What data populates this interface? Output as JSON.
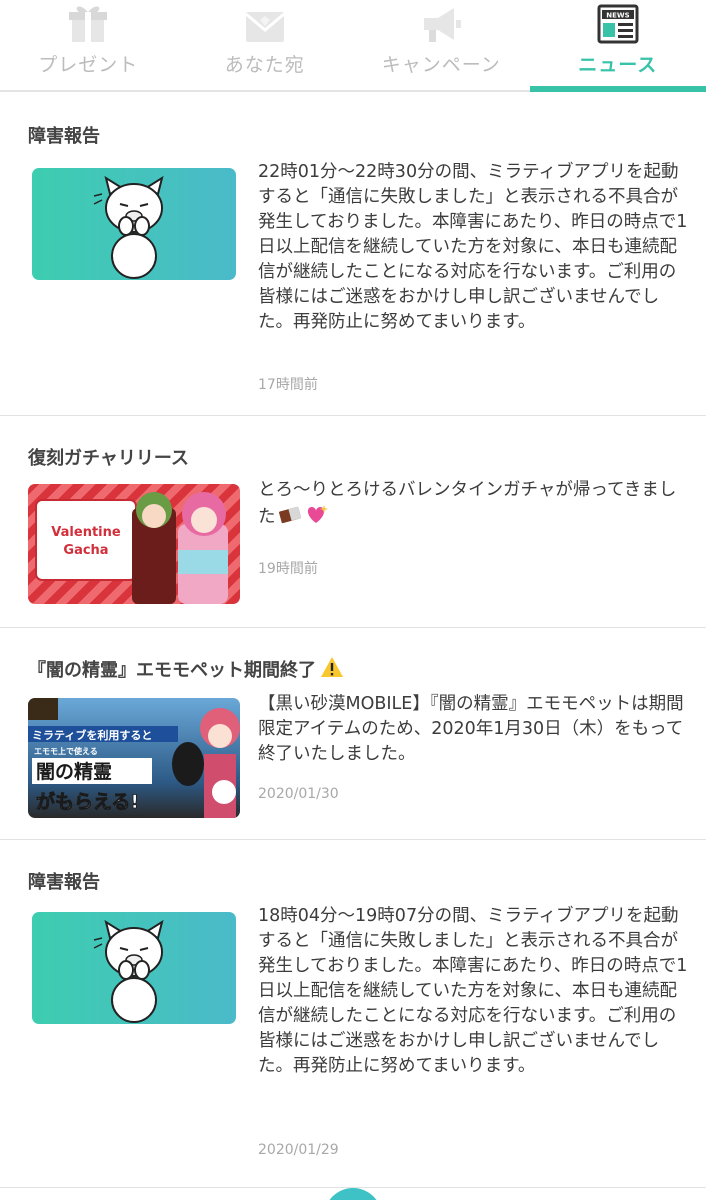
{
  "tabs": [
    {
      "label": "プレゼント",
      "icon": "gift-icon",
      "active": false
    },
    {
      "label": "あなた宛",
      "icon": "envelope-icon",
      "active": false
    },
    {
      "label": "キャンペーン",
      "icon": "megaphone-icon",
      "active": false
    },
    {
      "label": "ニュース",
      "icon": "newspaper-icon",
      "active": true
    }
  ],
  "news_badge_text": "NEWS",
  "colors": {
    "accent": "#38c3a8",
    "inactive": "#bcbcbc",
    "divider": "#e2e2e2",
    "thumb_teal": "#3fc2c6"
  },
  "news": [
    {
      "title": "障害報告",
      "body": "22時01分～22時30分の間、ミラティブアプリを起動すると「通信に失敗しました」と表示される不具合が発生しておりました。本障害にあたり、昨日の時点で1日以上配信を継続していた方を対象に、本日も連続配信が継続したことになる対応を行ないます。ご利用の皆様にはご迷惑をおかけし申し訳ございませんでした。再発防止に努めてまいります。",
      "date": "17時間前",
      "thumb": "dog-mascot-thumbnail"
    },
    {
      "title": "復刻ガチャリリース",
      "body": "とろ～りとろけるバレンタインガチャが帰ってきました",
      "body_emoji": [
        "chocolate-icon",
        "sparkle-heart-icon"
      ],
      "date": "19時間前",
      "thumb": "valentine-gacha-banner",
      "banner_text": "Valentine Gacha"
    },
    {
      "title": "『闇の精霊』エモモペット期間終了",
      "title_icon": "warning-icon",
      "body": "【黒い砂漠MOBILE】『闇の精霊』エモモペットは期間限定アイテムのため、2020年1月30日（木）をもって終了いたしました。",
      "date": "2020/01/30",
      "thumb": "dark-spirit-banner",
      "banner_lines": [
        "ミラティブを利用すると",
        "エモモ上で使える",
        "闇の精霊",
        "がもらえる!"
      ]
    },
    {
      "title": "障害報告",
      "body": "18時04分～19時07分の間、ミラティブアプリを起動すると「通信に失敗しました」と表示される不具合が発生しておりました。本障害にあたり、昨日の時点で1日以上配信を継続していた方を対象に、本日も連続配信が継続したことになる対応を行ないます。ご利用の皆様にはご迷惑をおかけし申し訳ございませんでした。再発防止に努めてまいります。",
      "date": "2020/01/29",
      "thumb": "dog-mascot-thumbnail"
    }
  ]
}
